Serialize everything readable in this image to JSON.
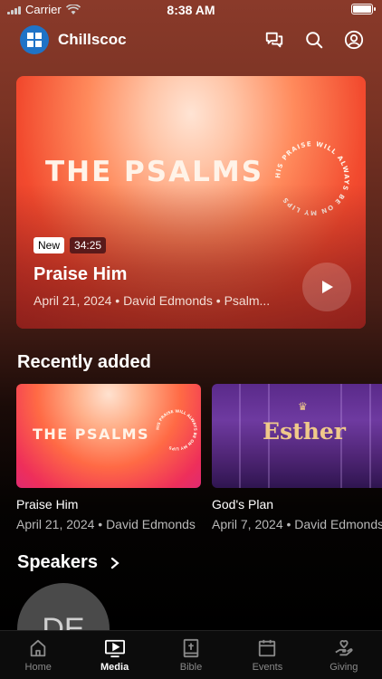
{
  "status_bar": {
    "carrier": "Carrier",
    "time": "8:38 AM"
  },
  "header": {
    "app_name": "Chillscoc"
  },
  "hero": {
    "art_title": "THE PSALMS",
    "art_ring_text": "HIS PRAISE WILL ALWAYS BE ON MY LIPS",
    "badge_new": "New",
    "duration": "34:25",
    "title": "Praise Him",
    "meta": "April 21, 2024 • David Edmonds • Psalm..."
  },
  "recently_added": {
    "title": "Recently added",
    "items": [
      {
        "art_title": "THE PSALMS",
        "title": "Praise Him",
        "meta": "April 21, 2024 • David Edmonds"
      },
      {
        "art_title": "Esther",
        "title": "God's Plan",
        "meta": "April 7, 2024 • David Edmonds"
      }
    ]
  },
  "speakers": {
    "title": "Speakers",
    "avatar_initials": "DE"
  },
  "tabs": [
    {
      "label": "Home",
      "icon": "home-icon"
    },
    {
      "label": "Media",
      "icon": "media-icon"
    },
    {
      "label": "Bible",
      "icon": "bible-icon"
    },
    {
      "label": "Events",
      "icon": "events-icon"
    },
    {
      "label": "Giving",
      "icon": "giving-icon"
    }
  ],
  "colors": {
    "accent_brand": "#1f73c7",
    "hero_orange": "#f24a2e",
    "esther_purple": "#6e3aa0"
  }
}
